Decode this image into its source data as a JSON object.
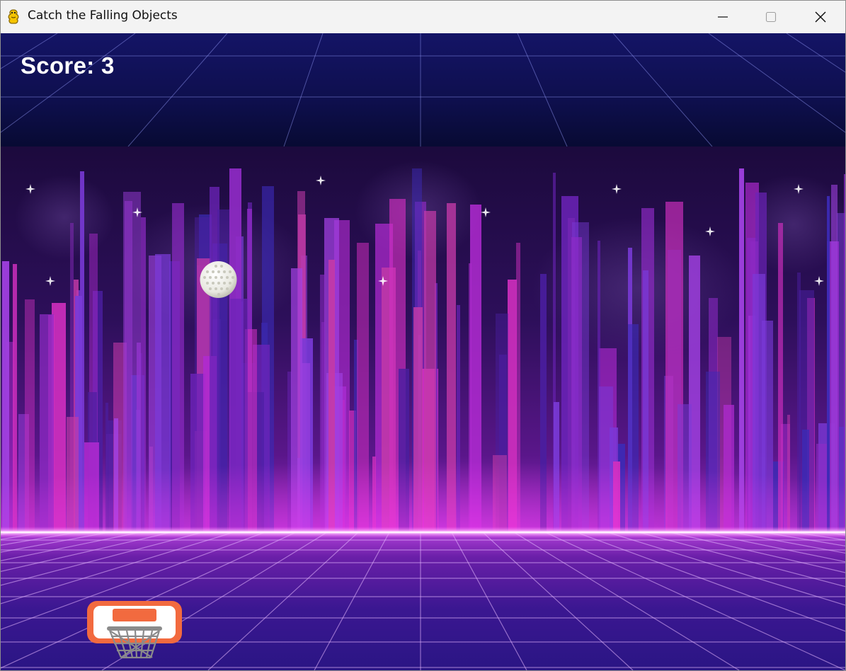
{
  "window": {
    "title": "Catch the Falling Objects",
    "app_icon": "pygame-snake-icon",
    "controls": [
      "minimize-icon",
      "maximize-icon",
      "close-icon"
    ]
  },
  "hud": {
    "score_label": "Score: 3",
    "score_value": 3
  },
  "objects": {
    "falling_object": "golf-ball",
    "player_catcher": "basketball-hoop"
  },
  "colors": {
    "sky_top": "#0f0f5a",
    "city_purple": "#2a0b4e",
    "horizon_glow": "#ff4dff",
    "floor": "#3a1488",
    "hoop_orange": "#f26a3f"
  }
}
